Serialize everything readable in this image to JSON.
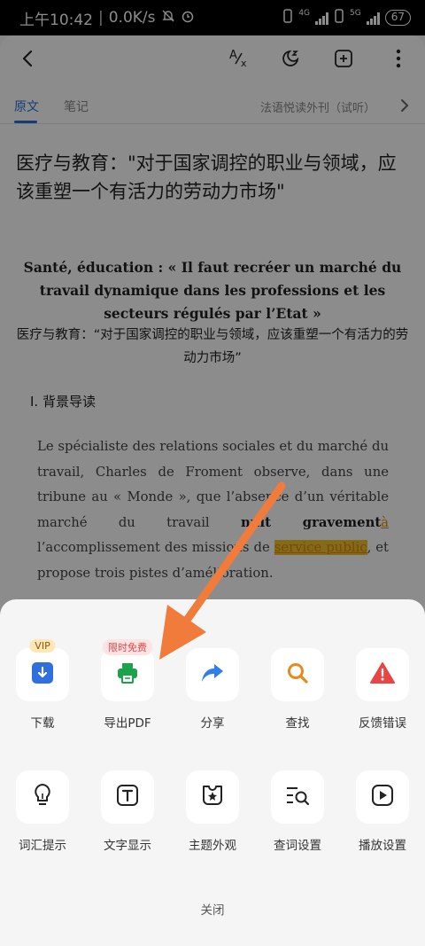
{
  "status": {
    "time": "上午10:42",
    "speed": "0.0K/s",
    "net1": "4G",
    "net2": "5G",
    "battery": "67"
  },
  "toolbar": {
    "back_icon": "back-arrow-icon",
    "translate_icon": "translate-icon",
    "timer_icon": "moon-timer-icon",
    "add_icon": "add-square-icon",
    "more_icon": "more-vertical-icon"
  },
  "tabs": {
    "original": "原文",
    "notes": "笔记",
    "series": "法语悦读外刊（试听）"
  },
  "article": {
    "title": "医疗与教育：\"对于国家调控的职业与领域，应该重塑一个有活力的劳动力市场\"",
    "fr_title": "Santé, éducation : « Il faut recréer un marché du travail dynamique dans les professions et les secteurs régulés par l’Etat »",
    "cn_subtitle": "医疗与教育：“对于国家调控的职业与领域，应该重塑一个有活力的劳动力市场”",
    "section": "I. 背景导读",
    "para_1": "Le spécialiste des relations sociales et du marché du travail, Charles de Froment observe, dans une tribune au « Monde », que l’absence d’un véritable marché du travail ",
    "para_bold": "nuit gravement",
    "para_link": "à",
    "para_2": " l’accomplissement des missions de ",
    "para_hl": "service public",
    "para_3": ", et propose trois pistes d’amélioration."
  },
  "sheet": {
    "row1": [
      {
        "label": "下载",
        "icon": "download-icon",
        "badge": "VIP"
      },
      {
        "label": "导出PDF",
        "icon": "printer-icon",
        "badge": "限时免费"
      },
      {
        "label": "分享",
        "icon": "share-arrow-icon",
        "badge": ""
      },
      {
        "label": "查找",
        "icon": "search-icon",
        "badge": ""
      },
      {
        "label": "反馈错误",
        "icon": "warning-icon",
        "badge": ""
      }
    ],
    "row2": [
      {
        "label": "词汇提示",
        "icon": "lightbulb-icon"
      },
      {
        "label": "文字显示",
        "icon": "text-box-icon"
      },
      {
        "label": "主题外观",
        "icon": "theme-star-icon"
      },
      {
        "label": "查词设置",
        "icon": "lookup-settings-icon"
      },
      {
        "label": "播放设置",
        "icon": "play-icon"
      }
    ],
    "close": "关闭"
  },
  "colors": {
    "accent": "#2a6fdb",
    "download": "#2f6fe0",
    "pdf": "#1aa34a",
    "share": "#2f7fe6",
    "search": "#e58a1e",
    "warning": "#e84545",
    "arrow": "#f07b3a",
    "highlight": "#f2c230"
  }
}
